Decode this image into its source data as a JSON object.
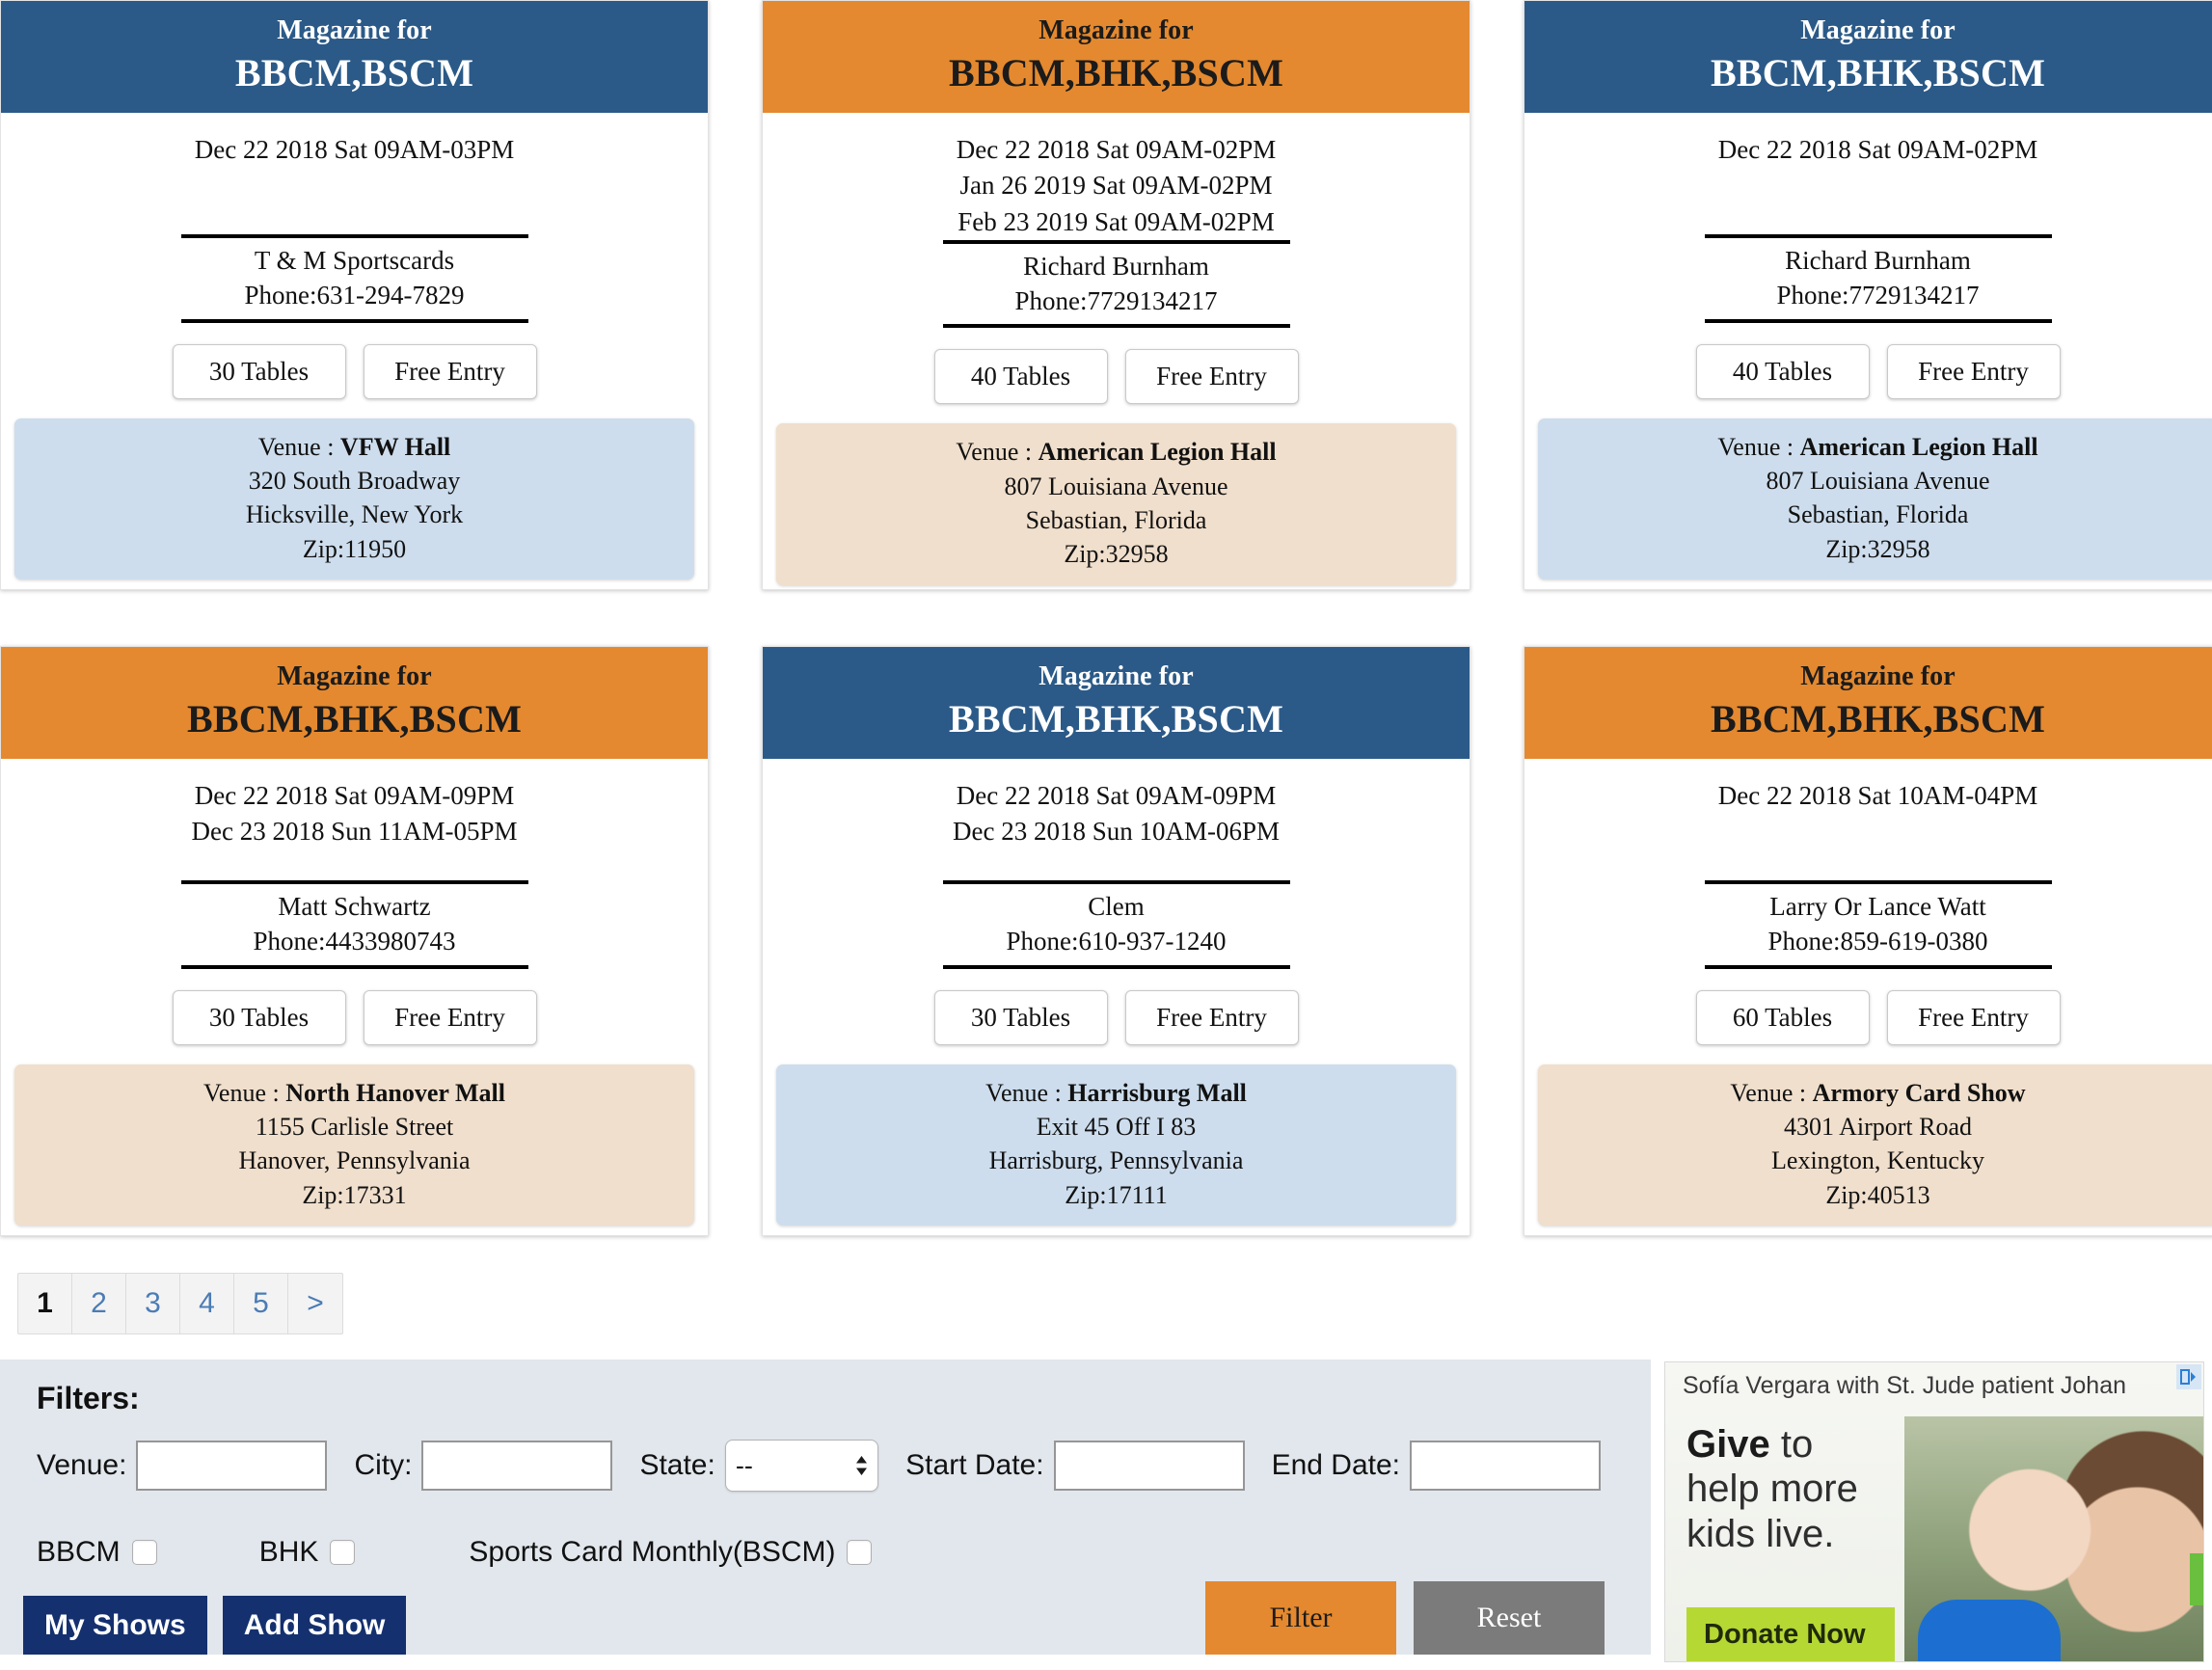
{
  "cards": [
    {
      "header_color": "blue",
      "magazine_for": "Magazine for",
      "codes": "BBCM,BSCM",
      "dates": [
        "Dec 22 2018 Sat 09AM-03PM"
      ],
      "contact_name": "T & M Sportscards",
      "contact_phone": "Phone:631-294-7829",
      "tables": "30 Tables",
      "entry": "Free Entry",
      "venue_tone": "lightblue",
      "venue_label": "Venue : ",
      "venue_name": "VFW Hall",
      "address": "320 South Broadway",
      "city_state": "Hicksville, New York",
      "zip": "Zip:11950"
    },
    {
      "header_color": "orange",
      "magazine_for": "Magazine for",
      "codes": "BBCM,BHK,BSCM",
      "dates": [
        "Dec 22 2018 Sat 09AM-02PM",
        "Jan 26 2019 Sat 09AM-02PM",
        "Feb 23 2019 Sat 09AM-02PM"
      ],
      "contact_name": "Richard Burnham",
      "contact_phone": "Phone:7729134217",
      "tables": "40 Tables",
      "entry": "Free Entry",
      "venue_tone": "tan",
      "venue_label": "Venue : ",
      "venue_name": "American Legion Hall",
      "address": "807 Louisiana Avenue",
      "city_state": "Sebastian, Florida",
      "zip": "Zip:32958"
    },
    {
      "header_color": "blue",
      "magazine_for": "Magazine for",
      "codes": "BBCM,BHK,BSCM",
      "dates": [
        "Dec 22 2018 Sat 09AM-02PM"
      ],
      "contact_name": "Richard Burnham",
      "contact_phone": "Phone:7729134217",
      "tables": "40 Tables",
      "entry": "Free Entry",
      "venue_tone": "lightblue",
      "venue_label": "Venue : ",
      "venue_name": "American Legion Hall",
      "address": "807 Louisiana Avenue",
      "city_state": "Sebastian, Florida",
      "zip": "Zip:32958"
    },
    {
      "header_color": "orange",
      "magazine_for": "Magazine for",
      "codes": "BBCM,BHK,BSCM",
      "dates": [
        "Dec 22 2018 Sat 09AM-09PM",
        "Dec 23 2018 Sun 11AM-05PM"
      ],
      "contact_name": "Matt Schwartz",
      "contact_phone": "Phone:4433980743",
      "tables": "30 Tables",
      "entry": "Free Entry",
      "venue_tone": "tan",
      "venue_label": "Venue : ",
      "venue_name": "North Hanover Mall",
      "address": "1155 Carlisle Street",
      "city_state": "Hanover, Pennsylvania",
      "zip": "Zip:17331"
    },
    {
      "header_color": "blue",
      "magazine_for": "Magazine for",
      "codes": "BBCM,BHK,BSCM",
      "dates": [
        "Dec 22 2018 Sat 09AM-09PM",
        "Dec 23 2018 Sun 10AM-06PM"
      ],
      "contact_name": "Clem",
      "contact_phone": "Phone:610-937-1240",
      "tables": "30 Tables",
      "entry": "Free Entry",
      "venue_tone": "lightblue",
      "venue_label": "Venue : ",
      "venue_name": "Harrisburg Mall",
      "address": "Exit 45 Off I 83",
      "city_state": "Harrisburg, Pennsylvania",
      "zip": "Zip:17111"
    },
    {
      "header_color": "orange",
      "magazine_for": "Magazine for",
      "codes": "BBCM,BHK,BSCM",
      "dates": [
        "Dec 22 2018 Sat 10AM-04PM"
      ],
      "contact_name": "Larry Or Lance Watt",
      "contact_phone": "Phone:859-619-0380",
      "tables": "60 Tables",
      "entry": "Free Entry",
      "venue_tone": "tan",
      "venue_label": "Venue : ",
      "venue_name": "Armory Card Show",
      "address": "4301 Airport Road",
      "city_state": "Lexington, Kentucky",
      "zip": "Zip:40513"
    }
  ],
  "pagination": {
    "pages": [
      "1",
      "2",
      "3",
      "4",
      "5",
      ">"
    ],
    "active_index": 0
  },
  "filters": {
    "title": "Filters:",
    "venue_label": "Venue:",
    "venue_value": "",
    "city_label": "City:",
    "city_value": "",
    "state_label": "State:",
    "state_value": "--",
    "start_date_label": "Start Date:",
    "start_date_value": "",
    "end_date_label": "End Date:",
    "end_date_value": "",
    "checkboxes": [
      {
        "label": "BBCM",
        "checked": false
      },
      {
        "label": "BHK",
        "checked": false
      },
      {
        "label": "Sports Card Monthly(BSCM)",
        "checked": false
      }
    ],
    "my_shows_label": "My Shows",
    "add_show_label": "Add Show",
    "filter_label": "Filter",
    "reset_label": "Reset"
  },
  "ad": {
    "caption": "Sofía Vergara with St. Jude patient Johan",
    "headline_bold": "Give",
    "headline_rest": " to",
    "headline_line2": "help more",
    "headline_line3": "kids live.",
    "cta": "Donate Now"
  },
  "colors": {
    "header_blue": "#2b5a88",
    "header_orange": "#e4892f",
    "venue_lightblue": "#cddded",
    "venue_tan": "#f0dfcc",
    "filters_bg": "#e2e7ed",
    "nav_button": "#14306e",
    "reset_gray": "#7b7b7b",
    "page_link": "#4b7cb5"
  }
}
